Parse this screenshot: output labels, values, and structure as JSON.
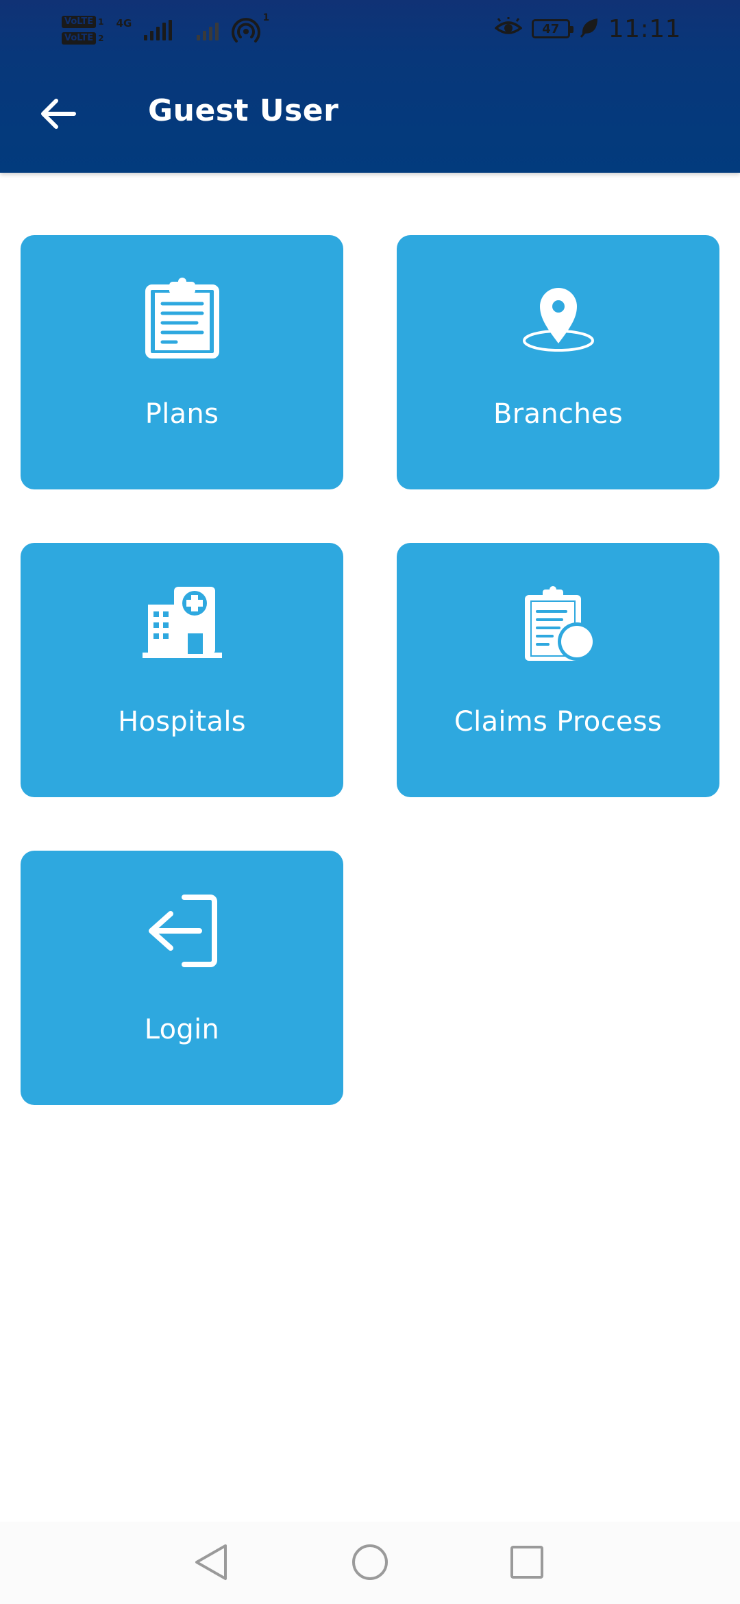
{
  "status_bar": {
    "volte_label": "VoLTE",
    "sim1": "1",
    "sim2": "2",
    "network_type": "4G",
    "hotspot_count": "1",
    "battery": "47",
    "time": "11:11"
  },
  "app_bar": {
    "title": "Guest User",
    "back_icon": "arrow-left-icon"
  },
  "tiles": [
    {
      "label": "Plans",
      "icon": "clipboard-icon"
    },
    {
      "label": "Branches",
      "icon": "location-pin-icon"
    },
    {
      "label": "Hospitals",
      "icon": "hospital-icon"
    },
    {
      "label": "Claims Process",
      "icon": "claims-clipboard-icon"
    },
    {
      "label": "Login",
      "icon": "login-icon"
    }
  ],
  "nav_bar": {
    "back": "nav-back-icon",
    "home": "nav-home-icon",
    "recents": "nav-recents-icon"
  },
  "colors": {
    "app_bar": "#023b7d",
    "tile": "#2ea8df",
    "tile_text": "#ffffff",
    "background": "#ffffff"
  }
}
